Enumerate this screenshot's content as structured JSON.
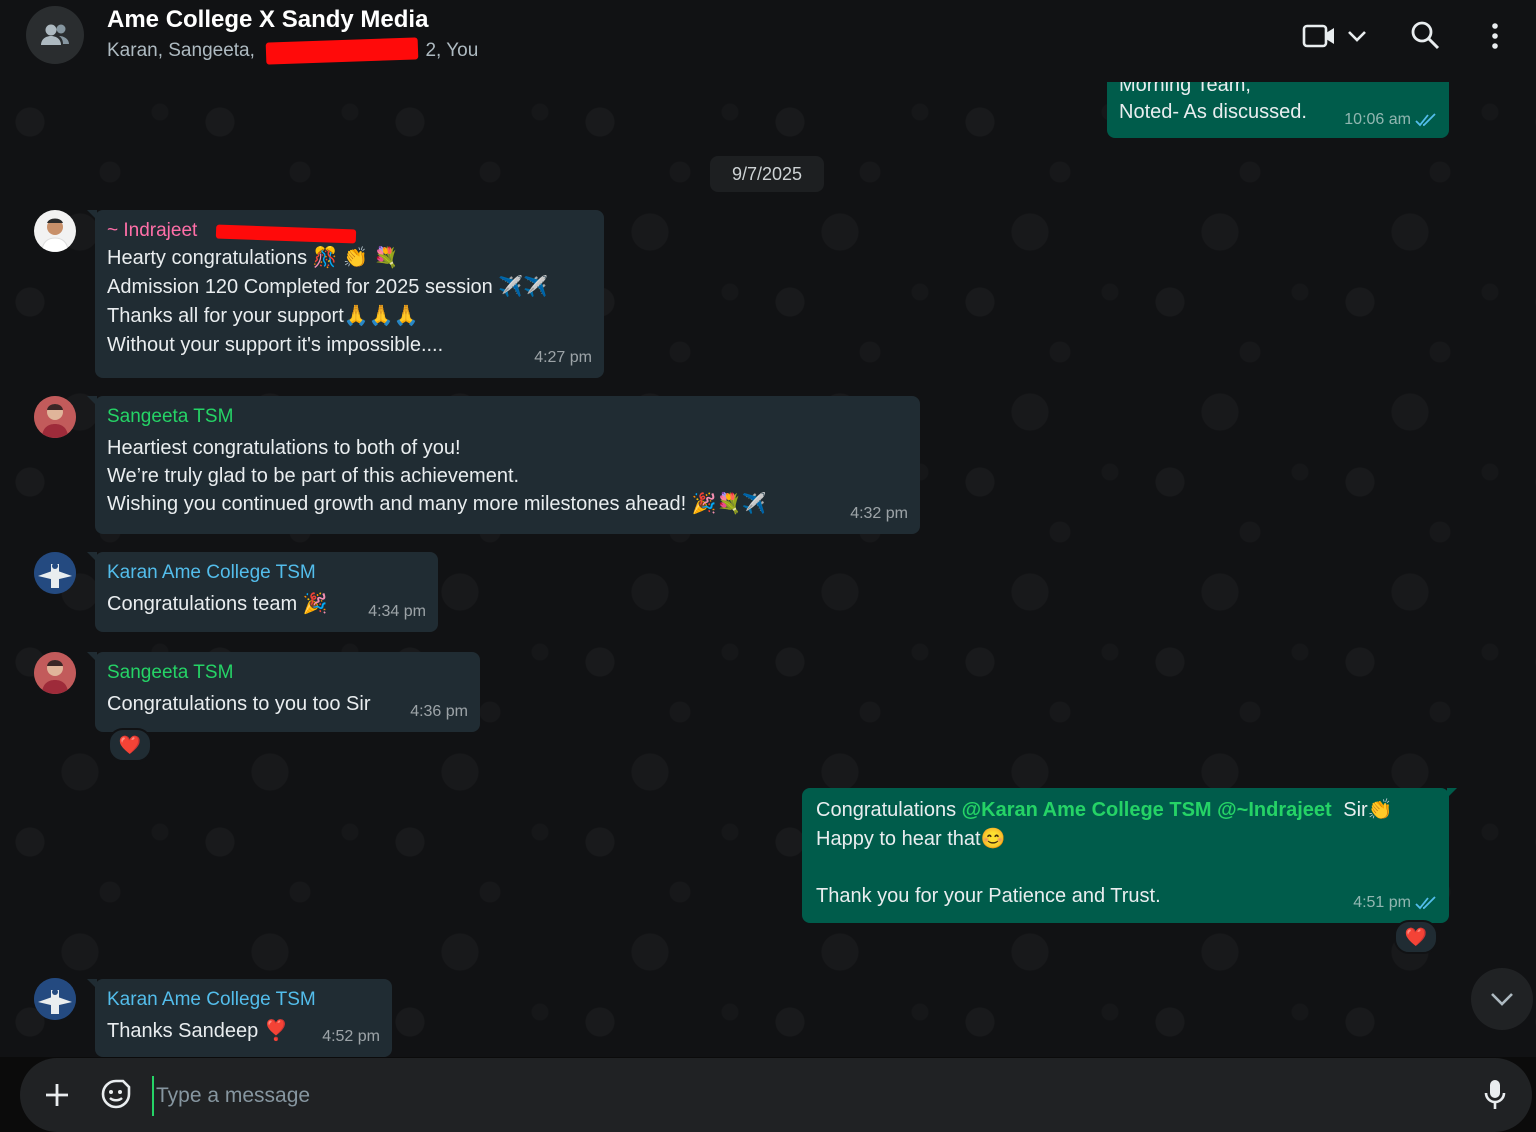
{
  "header": {
    "title": "Ame College X Sandy Media",
    "members_prefix": "Karan, Sangeeta,",
    "members_suffix": "2, You",
    "icons": [
      "group-avatar-icon",
      "video-call-icon",
      "chevron-down-icon",
      "search-icon",
      "menu-icon"
    ]
  },
  "messages": {
    "m0": {
      "line1": "Morning Team,",
      "line2": "Noted- As discussed.",
      "time": "10:06 am"
    },
    "date_chip": "9/7/2025",
    "m1": {
      "sender": "~ Indrajeet",
      "line1": "Hearty congratulations",
      "line2": "Admission 120 Completed for 2025 session",
      "line3": "Thanks all for your support",
      "line4": "Without your support it's impossible....",
      "time": "4:27 pm"
    },
    "m2": {
      "sender": "Sangeeta TSM",
      "line1": "Heartiest congratulations to both of you!",
      "line2": "We’re truly glad to be part of this achievement.",
      "line3": "Wishing you continued growth and many more milestones ahead!",
      "time": "4:32 pm"
    },
    "m3": {
      "sender": "Karan Ame College TSM",
      "text": "Congratulations team",
      "time": "4:34 pm"
    },
    "m4": {
      "sender": "Sangeeta TSM",
      "text": "Congratulations to you too Sir",
      "time": "4:36 pm",
      "reaction": "❤️"
    },
    "m5": {
      "text1": "Congratulations",
      "mention1": "@Karan Ame College TSM",
      "mention2": "@~Indrajeet",
      "text2": "Sir",
      "line2": "Happy to hear that",
      "line3": "Thank you for your Patience and Trust.",
      "time": "4:51 pm",
      "reaction": "❤️"
    },
    "m6": {
      "sender": "Karan Ame College TSM",
      "text": "Thanks Sandeep",
      "time": "4:52 pm"
    }
  },
  "emojis": {
    "celebration": "🎊",
    "clap": "👏",
    "bouquet": "💐",
    "plane": "✈️",
    "pray": "🙏",
    "party": "🎉",
    "smile": "😊",
    "heart": "❣️"
  },
  "composer": {
    "placeholder": "Type a message"
  },
  "colors": {
    "sender_indrajeet": "#ff6fa8",
    "sender_sangeeta": "#25d366",
    "sender_karan": "#53bdeb",
    "outgoing_bubble": "#005c4b",
    "incoming_bubble": "#202c33",
    "read_ticks": "#53bdeb"
  }
}
